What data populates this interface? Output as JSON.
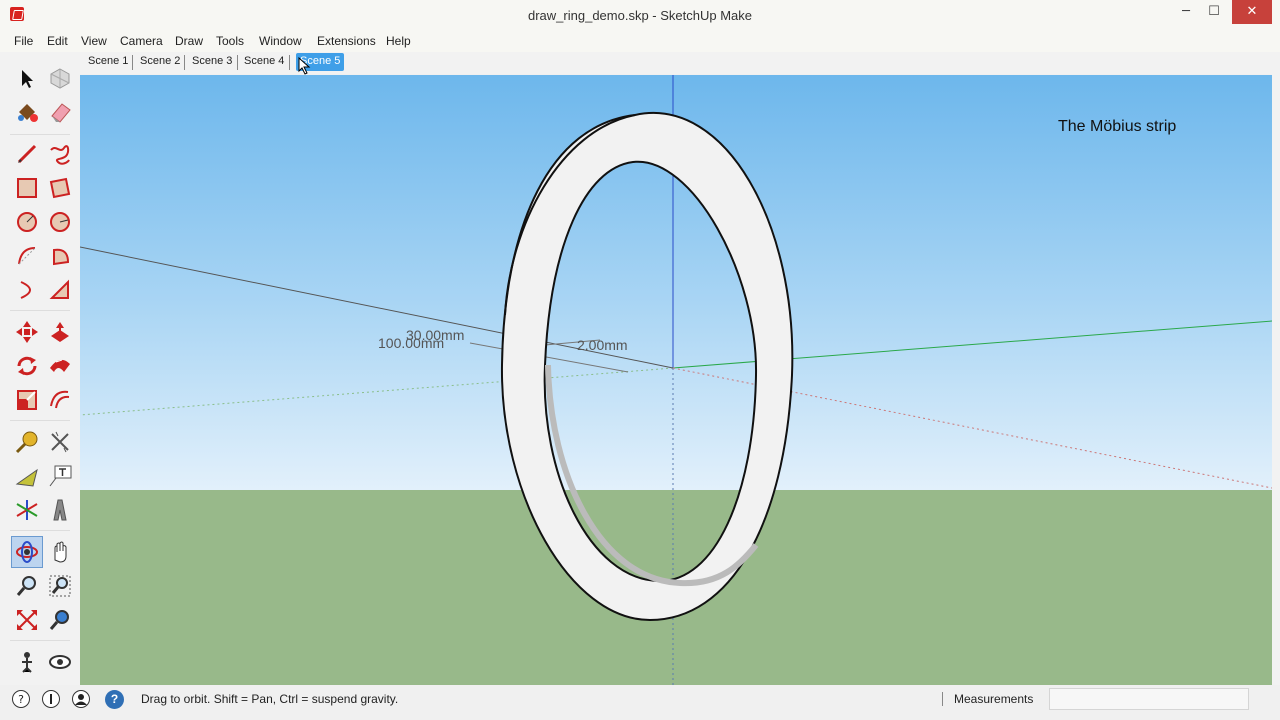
{
  "window": {
    "title": "draw_ring_demo.skp - SketchUp Make",
    "minimize_glyph": "─",
    "maximize_glyph": "☐",
    "close_glyph": "✕"
  },
  "menu": [
    "File",
    "Edit",
    "View",
    "Camera",
    "Draw",
    "Tools",
    "Window",
    "Extensions",
    "Help"
  ],
  "scenes": {
    "tabs": [
      "Scene 1",
      "Scene 2",
      "Scene 3",
      "Scene 4",
      "Scene 5"
    ],
    "active_index": 4
  },
  "toolbar": {
    "tools": [
      "select-tool",
      "component-tool",
      "paint-bucket-tool",
      "eraser-tool",
      "line-tool",
      "freehand-tool",
      "rectangle-tool",
      "rotated-rectangle-tool",
      "circle-tool",
      "polygon-tool",
      "arc-tool",
      "pie-tool",
      "two-point-arc-tool",
      "three-point-arc-tool",
      "move-tool",
      "push-pull-tool",
      "rotate-tool",
      "follow-me-tool",
      "scale-tool",
      "offset-tool",
      "tape-measure-tool",
      "dimension-tool",
      "protractor-tool",
      "text-tool",
      "axes-tool",
      "3d-text-tool",
      "orbit-tool",
      "pan-tool",
      "zoom-tool",
      "zoom-window-tool",
      "zoom-extents-tool",
      "previous-view-tool",
      "position-camera-tool",
      "look-around-tool"
    ],
    "active_tool": "orbit-tool"
  },
  "viewport": {
    "scene_title": "The Möbius strip",
    "dimension_1": "100.00mm",
    "dimension_2": "30.00mm",
    "dimension_3": "2.00mm",
    "sky_color": "#8cc6f0",
    "ground_color": "#98b98a",
    "model_color": "#ffffff"
  },
  "status": {
    "icons": [
      "geo-location-icon",
      "credits-icon",
      "user-icon"
    ],
    "help_glyph": "?",
    "text": "Drag to orbit. Shift = Pan, Ctrl = suspend gravity.",
    "measurements_label": "Measurements",
    "measurements_value": ""
  }
}
